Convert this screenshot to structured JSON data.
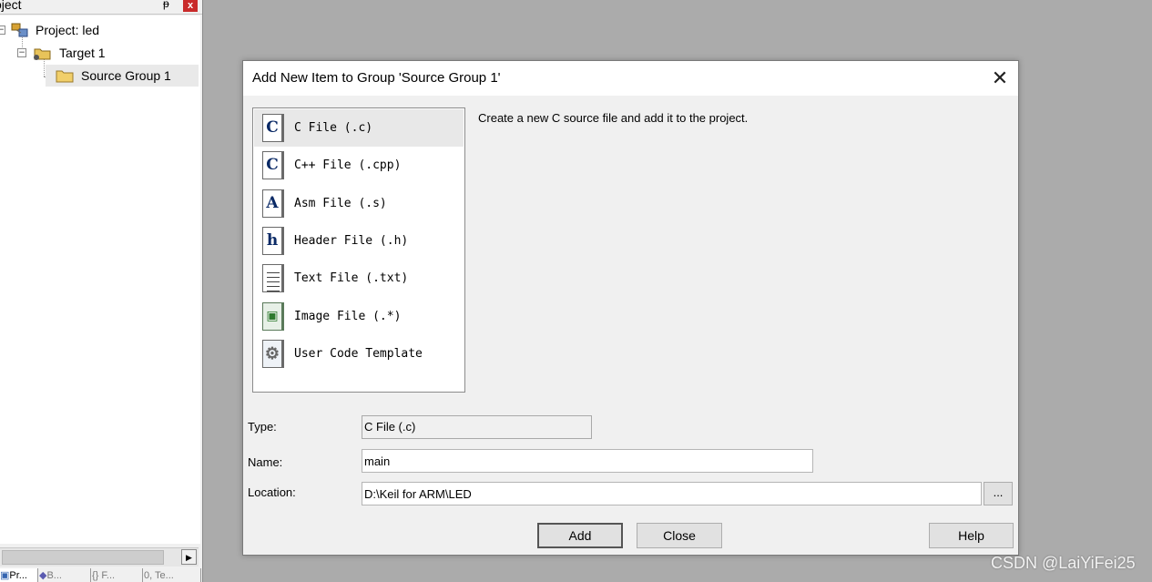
{
  "project_panel": {
    "title": "oject",
    "pin_glyph": "ᵽ",
    "close_glyph": "x",
    "tree": {
      "project": "Project: led",
      "target": "Target 1",
      "source_group": "Source Group 1",
      "collapse_glyph": "−"
    },
    "tabs": [
      "Pr...",
      "B...",
      "{} F...",
      "0, Te..."
    ]
  },
  "dialog": {
    "title": "Add New Item to Group 'Source Group 1'",
    "close_glyph": "✕",
    "file_types": [
      {
        "label": "C File (.c)",
        "icon": "c-file-icon",
        "glyph": "C"
      },
      {
        "label": "C++ File (.cpp)",
        "icon": "cpp-file-icon",
        "glyph": "C"
      },
      {
        "label": "Asm File (.s)",
        "icon": "asm-file-icon",
        "glyph": "A"
      },
      {
        "label": "Header File (.h)",
        "icon": "header-file-icon",
        "glyph": "h"
      },
      {
        "label": "Text File (.txt)",
        "icon": "text-file-icon",
        "glyph": ""
      },
      {
        "label": "Image File (.*)",
        "icon": "image-file-icon",
        "glyph": "▣"
      },
      {
        "label": "User Code Template",
        "icon": "template-gear-icon",
        "glyph": "⚙"
      }
    ],
    "selected_index": 0,
    "description": "Create a new C source file and add it to the project.",
    "fields": {
      "type_label": "Type:",
      "type_value": "C File (.c)",
      "name_label": "Name:",
      "name_value": "main",
      "location_label": "Location:",
      "location_value": "D:\\Keil for ARM\\LED"
    },
    "buttons": {
      "browse": "...",
      "add": "Add",
      "close": "Close",
      "help": "Help"
    }
  },
  "watermark": "CSDN @LaiYiFei25",
  "colors": {
    "background": "#ababab",
    "dialog_bg": "#f0f0f0",
    "icon_navy": "#0b2a66",
    "panel_close_red": "#c92b2b"
  }
}
